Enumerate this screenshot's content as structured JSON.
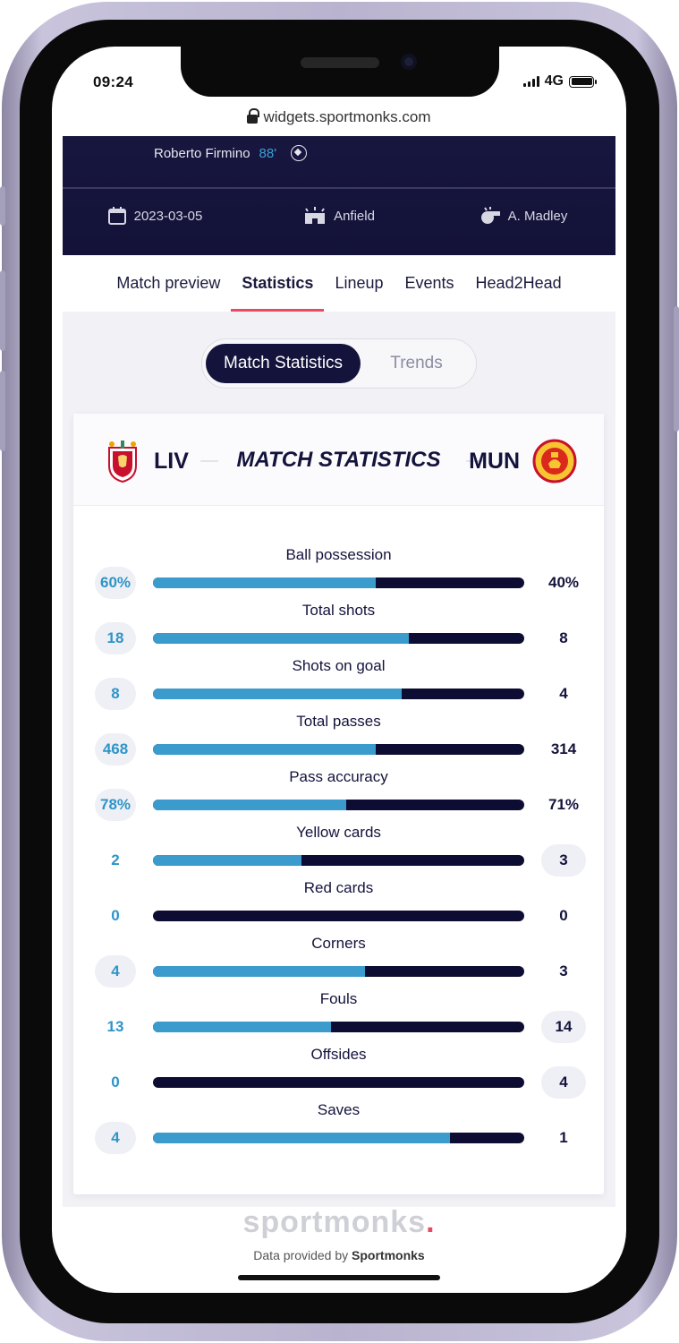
{
  "status_bar": {
    "time": "09:24",
    "network": "4G"
  },
  "browser": {
    "url": "widgets.sportmonks.com"
  },
  "match_header": {
    "scorer_name": "Roberto Firmino",
    "scorer_minute": "88'",
    "date": "2023-03-05",
    "venue": "Anfield",
    "referee": "A. Madley"
  },
  "tabs": [
    {
      "label": "Match preview"
    },
    {
      "label": "Statistics"
    },
    {
      "label": "Lineup"
    },
    {
      "label": "Events"
    },
    {
      "label": "Head2Head"
    }
  ],
  "active_tab": "Statistics",
  "toggle": {
    "active": "Match Statistics",
    "inactive": "Trends"
  },
  "card": {
    "title": "MATCH STATISTICS",
    "home_code": "LIV",
    "away_code": "MUN"
  },
  "colors": {
    "navy": "#14133c",
    "home_bar": "#3a9bcc",
    "accent": "#e84a62"
  },
  "stats": [
    {
      "label": "Ball possession",
      "home": "60%",
      "away": "40%",
      "home_share": 0.6,
      "pill": "home"
    },
    {
      "label": "Total shots",
      "home": "18",
      "away": "8",
      "home_share": 0.69,
      "pill": "home"
    },
    {
      "label": "Shots on goal",
      "home": "8",
      "away": "4",
      "home_share": 0.67,
      "pill": "home"
    },
    {
      "label": "Total passes",
      "home": "468",
      "away": "314",
      "home_share": 0.6,
      "pill": "home"
    },
    {
      "label": "Pass accuracy",
      "home": "78%",
      "away": "71%",
      "home_share": 0.52,
      "pill": "home"
    },
    {
      "label": "Yellow cards",
      "home": "2",
      "away": "3",
      "home_share": 0.4,
      "pill": "away"
    },
    {
      "label": "Red cards",
      "home": "0",
      "away": "0",
      "home_share": 0,
      "pill": "none"
    },
    {
      "label": "Corners",
      "home": "4",
      "away": "3",
      "home_share": 0.57,
      "pill": "home"
    },
    {
      "label": "Fouls",
      "home": "13",
      "away": "14",
      "home_share": 0.48,
      "pill": "away"
    },
    {
      "label": "Offsides",
      "home": "0",
      "away": "4",
      "home_share": 0,
      "pill": "away"
    },
    {
      "label": "Saves",
      "home": "4",
      "away": "1",
      "home_share": 0.8,
      "pill": "home"
    }
  ],
  "footer": {
    "logo": "sportmonks",
    "provided_prefix": "Data provided by",
    "provided_brand": "Sportmonks"
  }
}
